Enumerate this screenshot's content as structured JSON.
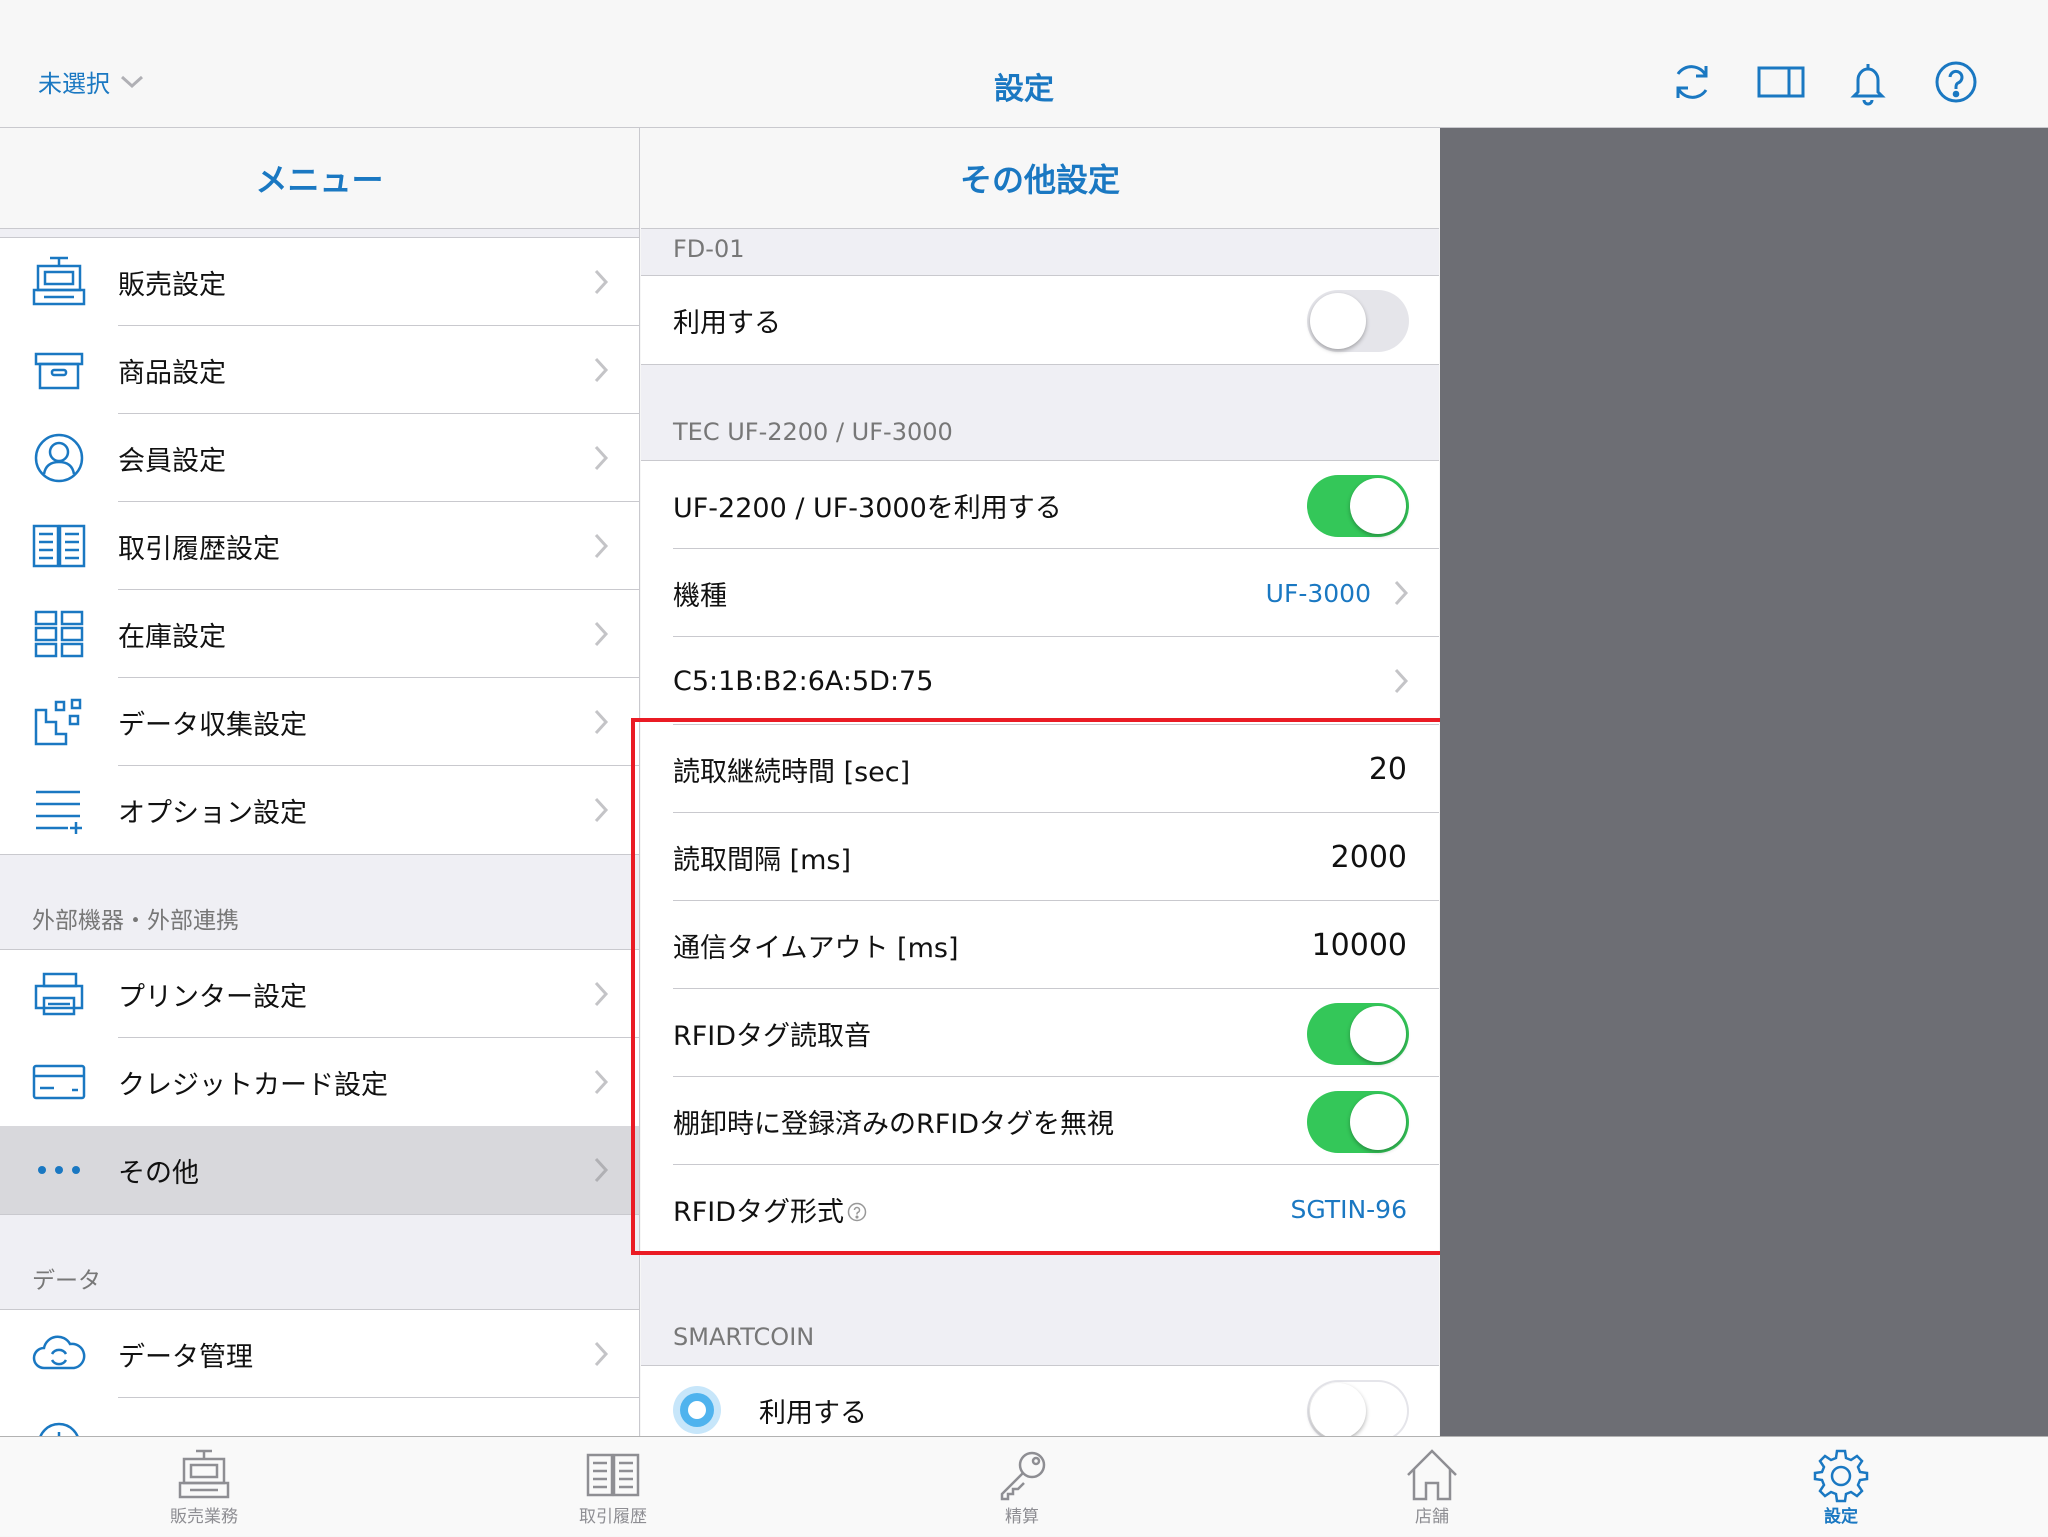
{
  "colors": {
    "accent": "#1a78c2",
    "toggle_on": "#34c759",
    "highlight": "#ea1b24",
    "detail_bg": "#6d6e74"
  },
  "topbar": {
    "store_select": "未選択",
    "title": "設定",
    "icons": [
      "refresh-icon",
      "split-view-icon",
      "bell-icon",
      "help-icon"
    ]
  },
  "menu": {
    "header": "メニュー",
    "items": [
      {
        "label": "販売設定",
        "icon": "register-icon"
      },
      {
        "label": "商品設定",
        "icon": "box-icon"
      },
      {
        "label": "会員設定",
        "icon": "person-icon"
      },
      {
        "label": "取引履歴設定",
        "icon": "book-icon"
      },
      {
        "label": "在庫設定",
        "icon": "shelves-icon"
      },
      {
        "label": "データ収集設定",
        "icon": "data-collection-icon"
      },
      {
        "label": "オプション設定",
        "icon": "list-plus-icon"
      }
    ],
    "section_external": "外部機器・外部連携",
    "external_items": [
      {
        "label": "プリンター設定",
        "icon": "printer-icon"
      },
      {
        "label": "クレジットカード設定",
        "icon": "credit-card-icon"
      },
      {
        "label": "その他",
        "icon": "more-dots-icon"
      }
    ],
    "section_data": "データ",
    "data_items": [
      {
        "label": "データ管理",
        "icon": "cloud-sync-icon"
      }
    ]
  },
  "settings": {
    "header": "その他設定",
    "fd01": {
      "section": "FD-01",
      "use_label": "利用する",
      "use_on": false
    },
    "tec": {
      "section": "TEC UF-2200 / UF-3000",
      "use_label": "UF-2200 / UF-3000を利用する",
      "use_on": true,
      "model_label": "機種",
      "model_value": "UF-3000",
      "mac_address": "C5:1B:B2:6A:5D:75",
      "read_duration_label": "読取継続時間 [sec]",
      "read_duration_value": "20",
      "read_interval_label": "読取間隔 [ms]",
      "read_interval_value": "2000",
      "timeout_label": "通信タイムアウト [ms]",
      "timeout_value": "10000",
      "rfid_sound_label": "RFIDタグ読取音",
      "rfid_sound_on": true,
      "ignore_registered_label": "棚卸時に登録済みのRFIDタグを無視",
      "ignore_registered_on": true,
      "rfid_format_label": "RFIDタグ形式",
      "rfid_format_value": "SGTIN-96"
    },
    "smartcoin": {
      "section": "SMARTCOIN",
      "use_label": "利用する",
      "use_on": false
    }
  },
  "tabbar": {
    "tabs": [
      {
        "label": "販売業務",
        "icon": "register-icon",
        "active": false
      },
      {
        "label": "取引履歴",
        "icon": "book-icon",
        "active": false
      },
      {
        "label": "精算",
        "icon": "key-icon",
        "active": false
      },
      {
        "label": "店舗",
        "icon": "house-icon",
        "active": false
      },
      {
        "label": "設定",
        "icon": "gear-icon",
        "active": true
      }
    ]
  }
}
